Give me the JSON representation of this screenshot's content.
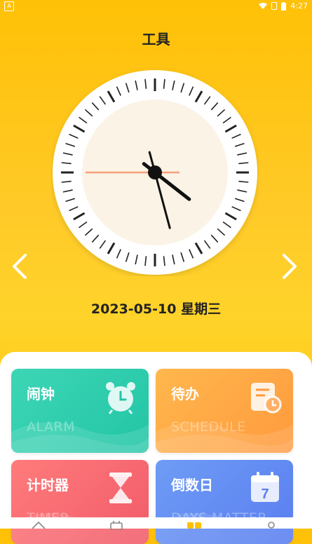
{
  "status_bar": {
    "left_icon": "A",
    "time": "4:27",
    "icons": [
      "wifi-icon",
      "sim-icon",
      "battery-icon"
    ]
  },
  "header": {
    "title": "工具"
  },
  "clock": {
    "hour_hand_angle_deg": 128,
    "minute_hand_angle_deg": 165,
    "second_hand_angle_deg": 270,
    "face_color": "#FBF3E6",
    "second_hand_color": "#F4A07A"
  },
  "date": {
    "text": "2023-05-10 星期三"
  },
  "cards": [
    {
      "label": "闹钟",
      "sub": "ALARM",
      "icon": "alarm-clock-icon"
    },
    {
      "label": "待办",
      "sub": "SCHEDULE",
      "icon": "schedule-icon"
    },
    {
      "label": "计时器",
      "sub": "TIMER",
      "icon": "hourglass-icon"
    },
    {
      "label": "倒数日",
      "sub": "DAYS MATTER",
      "icon": "calendar-icon",
      "icon_number": "7"
    }
  ],
  "bottom_nav": {
    "items": [
      "home-icon",
      "calendar-icon",
      "tools-icon",
      "profile-icon"
    ]
  },
  "colors": {
    "background": "#FFC107",
    "alarm": "#22C5A6",
    "schedule": "#FF9A3D",
    "timer": "#F15B6A",
    "countdown": "#5A7EF0"
  }
}
